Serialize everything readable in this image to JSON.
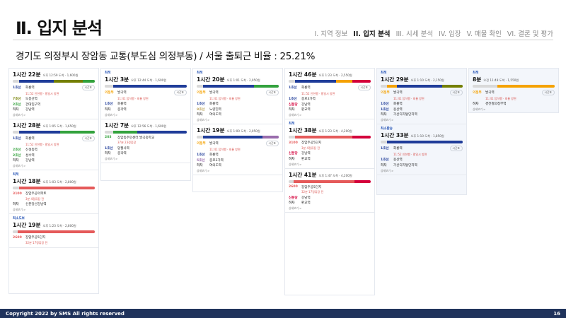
{
  "header": {
    "title": "Ⅱ. 입지 분석",
    "nav": [
      {
        "label": "I. 지역 정보",
        "active": false
      },
      {
        "label": "II. 입지 분석",
        "active": true
      },
      {
        "label": "III. 시세 분석",
        "active": false
      },
      {
        "label": "IV. 임장",
        "active": false
      },
      {
        "label": "V. 매물 확인",
        "active": false
      },
      {
        "label": "VI. 결론 및 평가",
        "active": false
      }
    ]
  },
  "subtitle": "경기도 의정부시 장암동 교통(부도심 의정부동) / 서울 출퇴근 비율 : 25.21%",
  "colors": {
    "line1": "#1f3c99",
    "line7": "#747f00",
    "bundang": "#f5a200",
    "ujeongbu": "#f5a200",
    "line4": "#2ea0db",
    "line2": "#33a23d",
    "line5": "#996cac",
    "gyeongchun": "#0c8e72",
    "bus": "#e55a5a",
    "footer": "#20335c"
  },
  "columns": [
    {
      "tinted": false,
      "cards": [
        {
          "tag": "",
          "time": "1시간 22분",
          "meta": "오후 12:59 도착 · 1,600원",
          "segments": [
            {
              "c": "#d9d9d9",
              "w": 8
            },
            {
              "c": "#1f3c99",
              "w": 42
            },
            {
              "c": "#747f00",
              "w": 35
            },
            {
              "c": "#33a23d",
              "w": 15
            }
          ],
          "steps": [
            {
              "line": "1호선",
              "color": "#1f3c99",
              "name": "회룡역",
              "sub": "11:52 인천행 · 평일시 방면",
              "pill": "시간표"
            },
            {
              "line": "7호선",
              "color": "#747f00",
              "name": "도봉산역",
              "sub": "",
              "pill": ""
            },
            {
              "line": "2호선",
              "color": "#33a23d",
              "name": "건대입구역",
              "sub": "",
              "pill": ""
            },
            {
              "line": "하차",
              "color": "#555555",
              "name": "강남역",
              "sub": "",
              "pill": ""
            }
          ],
          "foot": "상세보기 >"
        },
        {
          "tag": "",
          "time": "1시간 28분",
          "meta": "오후 1:05 도착 · 1,650원",
          "segments": [
            {
              "c": "#d9d9d9",
              "w": 8
            },
            {
              "c": "#1f3c99",
              "w": 50
            },
            {
              "c": "#33a23d",
              "w": 42
            }
          ],
          "steps": [
            {
              "line": "1호선",
              "color": "#1f3c99",
              "name": "회룡역",
              "sub": "11:52 인천행 · 평일시 방면",
              "pill": "시간표"
            },
            {
              "line": "2호선",
              "color": "#33a23d",
              "name": "신설동역",
              "sub": "",
              "pill": ""
            },
            {
              "line": "2호선",
              "color": "#33a23d",
              "name": "성수역",
              "sub": "",
              "pill": ""
            },
            {
              "line": "하차",
              "color": "#555555",
              "name": "강남역",
              "sub": "",
              "pill": ""
            }
          ],
          "foot": "상세보기 >"
        },
        {
          "tag": "최적",
          "time": "1시간 18분",
          "meta": "오후 1:03 도착 · 2,800원",
          "segments": [
            {
              "c": "#d9d9d9",
              "w": 8
            },
            {
              "c": "#e55a5a",
              "w": 92
            }
          ],
          "steps": [
            {
              "line": "3100",
              "color": "#e55a5a",
              "name": "장암주공아파트",
              "sub": "3분 4정류장 전",
              "pill": ""
            },
            {
              "line": "하차",
              "color": "#555555",
              "name": "신분당선강남역",
              "sub": "",
              "pill": ""
            }
          ],
          "foot": "상세보기 >"
        },
        {
          "tag": "최소도보",
          "time": "1시간 19분",
          "meta": "오후 1:23 도착 · 2,800원",
          "segments": [
            {
              "c": "#d9d9d9",
              "w": 6
            },
            {
              "c": "#e55a5a",
              "w": 94
            }
          ],
          "steps": [
            {
              "line": "2600",
              "color": "#e55a5a",
              "name": "장암주공5단지",
              "sub": "32분 17정류장 전",
              "pill": ""
            }
          ],
          "foot": ""
        }
      ]
    },
    {
      "tinted": false,
      "cards": [
        {
          "tag": "최적",
          "time": "1시간 3분",
          "meta": "오후 12:44 도착 · 1,600원",
          "segments": [
            {
              "c": "#d9d9d9",
              "w": 10
            },
            {
              "c": "#1f3c99",
              "w": 90
            }
          ],
          "steps": [
            {
              "line": "의정부",
              "color": "#f5a200",
              "name": "발곡역",
              "sub": "11:41 탑석행 · 회룡 방면",
              "pill": "시간표"
            },
            {
              "line": "1호선",
              "color": "#1f3c99",
              "name": "회룡역",
              "sub": "",
              "pill": ""
            },
            {
              "line": "하차",
              "color": "#555555",
              "name": "종각역",
              "sub": "",
              "pill": ""
            }
          ],
          "foot": "상세보기 >"
        },
        {
          "tag": "",
          "time": "1시간 7분",
          "meta": "오후 12:56 도착 · 1,600원",
          "segments": [
            {
              "c": "#d9d9d9",
              "w": 10
            },
            {
              "c": "#33a23d",
              "w": 30
            },
            {
              "c": "#1f3c99",
              "w": 60
            }
          ],
          "steps": [
            {
              "line": "203",
              "color": "#33a23d",
              "name": "장암동주민센터.발곡중학교",
              "sub": "37분 23정류장",
              "pill": ""
            },
            {
              "line": "1호선",
              "color": "#1f3c99",
              "name": "망월사역",
              "sub": "",
              "pill": ""
            },
            {
              "line": "하차",
              "color": "#555555",
              "name": "종각역",
              "sub": "",
              "pill": ""
            }
          ],
          "foot": "상세보기 >"
        }
      ]
    },
    {
      "tinted": false,
      "cards": [
        {
          "tag": "최적",
          "time": "1시간 20분",
          "meta": "오후 1:01 도착 · 2,050원",
          "segments": [
            {
              "c": "#d9d9d9",
              "w": 8
            },
            {
              "c": "#1f3c99",
              "w": 62
            },
            {
              "c": "#33a23d",
              "w": 30
            }
          ],
          "steps": [
            {
              "line": "의정부",
              "color": "#f5a200",
              "name": "발곡역",
              "sub": "11:41 탑석행 · 회룡 방면",
              "pill": "시간표"
            },
            {
              "line": "1호선",
              "color": "#1f3c99",
              "name": "회룡역",
              "sub": "",
              "pill": ""
            },
            {
              "line": "9호선",
              "color": "#bda55d",
              "name": "노량진역",
              "sub": "",
              "pill": ""
            },
            {
              "line": "하차",
              "color": "#555555",
              "name": "여의도역",
              "sub": "",
              "pill": ""
            }
          ],
          "foot": "상세보기 >"
        },
        {
          "tag": "",
          "time": "1시간 19분",
          "meta": "오후 1:00 도착 · 2,050원",
          "segments": [
            {
              "c": "#d9d9d9",
              "w": 8
            },
            {
              "c": "#1f3c99",
              "w": 72
            },
            {
              "c": "#996cac",
              "w": 20
            }
          ],
          "steps": [
            {
              "line": "의정부",
              "color": "#f5a200",
              "name": "발곡역",
              "sub": "11:41 탑석행 · 회룡 방면",
              "pill": "시간표"
            },
            {
              "line": "1호선",
              "color": "#1f3c99",
              "name": "회룡역",
              "sub": "",
              "pill": ""
            },
            {
              "line": "5호선",
              "color": "#996cac",
              "name": "종로3가역",
              "sub": "",
              "pill": ""
            },
            {
              "line": "하차",
              "color": "#555555",
              "name": "여의도역",
              "sub": "",
              "pill": ""
            }
          ],
          "foot": "상세보기 >"
        }
      ]
    },
    {
      "tinted": false,
      "cards": [
        {
          "tag": "",
          "time": "1시간 46분",
          "meta": "오후 1:23 도착 · 2,550원",
          "segments": [
            {
              "c": "#d9d9d9",
              "w": 8
            },
            {
              "c": "#1f3c99",
              "w": 50
            },
            {
              "c": "#f5a200",
              "w": 20
            },
            {
              "c": "#d4003b",
              "w": 22
            }
          ],
          "steps": [
            {
              "line": "1호선",
              "color": "#1f3c99",
              "name": "회룡역",
              "sub": "11:52 인천행 · 평일시 방면",
              "pill": "시간표"
            },
            {
              "line": "1호선",
              "color": "#1f3c99",
              "name": "종로3가역",
              "sub": "",
              "pill": ""
            },
            {
              "line": "신분당",
              "color": "#d4003b",
              "name": "강남역",
              "sub": "",
              "pill": ""
            },
            {
              "line": "하차",
              "color": "#555555",
              "name": "판교역",
              "sub": "",
              "pill": ""
            }
          ],
          "foot": "상세보기 >"
        },
        {
          "tag": "최적",
          "time": "1시간 38분",
          "meta": "오후 1:23 도착 · 4,200원",
          "segments": [
            {
              "c": "#d9d9d9",
              "w": 8
            },
            {
              "c": "#e55a5a",
              "w": 70
            },
            {
              "c": "#d4003b",
              "w": 22
            }
          ],
          "steps": [
            {
              "line": "3100",
              "color": "#e55a5a",
              "name": "장암주공5단지",
              "sub": "3분 4정류장 전",
              "pill": ""
            },
            {
              "line": "신분당",
              "color": "#d4003b",
              "name": "강남역",
              "sub": "",
              "pill": ""
            },
            {
              "line": "하차",
              "color": "#555555",
              "name": "판교역",
              "sub": "",
              "pill": ""
            }
          ],
          "foot": "상세보기 >"
        },
        {
          "tag": "",
          "time": "1시간 41분",
          "meta": "오후 1:47 도착 · 4,200원",
          "segments": [
            {
              "c": "#d9d9d9",
              "w": 6
            },
            {
              "c": "#e55a5a",
              "w": 74
            },
            {
              "c": "#d4003b",
              "w": 20
            }
          ],
          "steps": [
            {
              "line": "2600",
              "color": "#e55a5a",
              "name": "장암주공5단지",
              "sub": "32분 17정류장 전",
              "pill": ""
            },
            {
              "line": "신분당",
              "color": "#d4003b",
              "name": "강남역",
              "sub": "",
              "pill": ""
            },
            {
              "line": "하차",
              "color": "#555555",
              "name": "판교역",
              "sub": "",
              "pill": ""
            }
          ],
          "foot": "상세보기 >"
        }
      ]
    },
    {
      "tinted": true,
      "cards": [
        {
          "tag": "최적",
          "time": "1시간 29분",
          "meta": "오후 1:10 도착 · 2,150원",
          "segments": [
            {
              "c": "#d9d9d9",
              "w": 8
            },
            {
              "c": "#f5a200",
              "w": 12
            },
            {
              "c": "#1f3c99",
              "w": 55
            },
            {
              "c": "#747f00",
              "w": 25
            }
          ],
          "steps": [
            {
              "line": "의정부",
              "color": "#f5a200",
              "name": "발곡역",
              "sub": "11:41 탑석행 · 회룡 방면",
              "pill": "시간표"
            },
            {
              "line": "1호선",
              "color": "#1f3c99",
              "name": "회룡역",
              "sub": "",
              "pill": ""
            },
            {
              "line": "1호선",
              "color": "#1f3c99",
              "name": "용산역",
              "sub": "",
              "pill": ""
            },
            {
              "line": "하차",
              "color": "#555555",
              "name": "가산디지털단지역",
              "sub": "",
              "pill": ""
            }
          ],
          "foot": "상세보기 >"
        },
        {
          "tag": "최소환승",
          "time": "1시간 33분",
          "meta": "오후 1:10 도착 · 1,850원",
          "segments": [
            {
              "c": "#d9d9d9",
              "w": 8
            },
            {
              "c": "#1f3c99",
              "w": 92
            }
          ],
          "steps": [
            {
              "line": "1호선",
              "color": "#1f3c99",
              "name": "회룡역",
              "sub": "11:52 인천행 · 평일시 방면",
              "pill": "시간표"
            },
            {
              "line": "1호선",
              "color": "#1f3c99",
              "name": "용산역",
              "sub": "",
              "pill": ""
            },
            {
              "line": "하차",
              "color": "#555555",
              "name": "가산디지털단지역",
              "sub": "",
              "pill": ""
            }
          ],
          "foot": "상세보기 >"
        }
      ]
    },
    {
      "tinted": true,
      "cards": [
        {
          "tag": "최적",
          "time": "8분",
          "meta": "오전 11:49 도착 · 1,550원",
          "segments": [
            {
              "c": "#d9d9d9",
              "w": 30
            },
            {
              "c": "#f5a200",
              "w": 70
            }
          ],
          "steps": [
            {
              "line": "의정부",
              "color": "#f5a200",
              "name": "발곡역",
              "sub": "11:41 탑석행 · 회룡 방면",
              "pill": "시간표"
            },
            {
              "line": "하차",
              "color": "#555555",
              "name": "경전철의정부역",
              "sub": "",
              "pill": ""
            }
          ],
          "foot": "상세보기 >"
        }
      ]
    }
  ],
  "footer": {
    "copyright": "Copyright 2022 by SMS All rights reserved",
    "page": "16"
  }
}
